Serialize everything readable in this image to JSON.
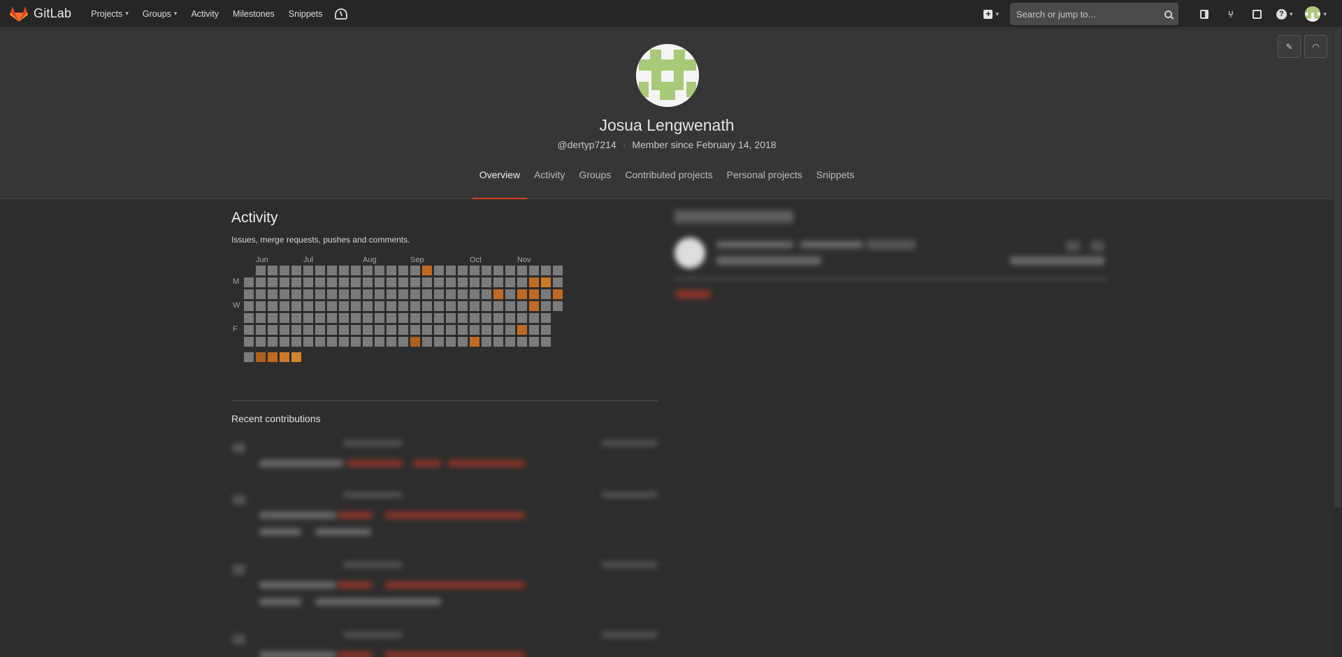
{
  "app": {
    "brand": "GitLab"
  },
  "nav": {
    "items": [
      {
        "label": "Projects",
        "dropdown": true
      },
      {
        "label": "Groups",
        "dropdown": true
      },
      {
        "label": "Activity",
        "dropdown": false
      },
      {
        "label": "Milestones",
        "dropdown": false
      },
      {
        "label": "Snippets",
        "dropdown": false
      }
    ],
    "search_placeholder": "Search or jump to...",
    "chevron": "⌄"
  },
  "profile": {
    "name": "Josua Lengwenath",
    "username": "@dertyp7214",
    "member_since": "Member since February 14, 2018",
    "separator": "·"
  },
  "tabs": [
    {
      "label": "Overview",
      "active": true
    },
    {
      "label": "Activity",
      "active": false
    },
    {
      "label": "Groups",
      "active": false
    },
    {
      "label": "Contributed projects",
      "active": false
    },
    {
      "label": "Personal projects",
      "active": false
    },
    {
      "label": "Snippets",
      "active": false
    }
  ],
  "activity": {
    "title": "Activity",
    "subtitle": "Issues, merge requests, pushes and comments.",
    "months": [
      {
        "label": "Jun",
        "week": 1
      },
      {
        "label": "Jul",
        "week": 5
      },
      {
        "label": "Aug",
        "week": 10
      },
      {
        "label": "Sep",
        "week": 14
      },
      {
        "label": "Oct",
        "week": 19
      },
      {
        "label": "Nov",
        "week": 23
      }
    ],
    "day_labels": [
      {
        "label": "M",
        "row": 1
      },
      {
        "label": "W",
        "row": 3
      },
      {
        "label": "F",
        "row": 5
      }
    ],
    "contributions": [
      {
        "week": 15,
        "day": 0,
        "level": 2
      },
      {
        "week": 24,
        "day": 1,
        "level": 2
      },
      {
        "week": 25,
        "day": 1,
        "level": 3
      },
      {
        "week": 21,
        "day": 2,
        "level": 2
      },
      {
        "week": 23,
        "day": 2,
        "level": 2
      },
      {
        "week": 24,
        "day": 2,
        "level": 2
      },
      {
        "week": 26,
        "day": 2,
        "level": 2
      },
      {
        "week": 24,
        "day": 3,
        "level": 2
      },
      {
        "week": 23,
        "day": 5,
        "level": 2
      },
      {
        "week": 14,
        "day": 6,
        "level": 1
      },
      {
        "week": 19,
        "day": 6,
        "level": 2
      }
    ],
    "weeks": 27,
    "last_week_days": 4
  },
  "recent": {
    "title": "Recent contributions"
  },
  "colors": {
    "accent": "#db3b21",
    "cell_empty": "#7b7b7b",
    "cell_active": "#c06a22",
    "background": "#2d2d2d",
    "header_bg": "#363636"
  }
}
